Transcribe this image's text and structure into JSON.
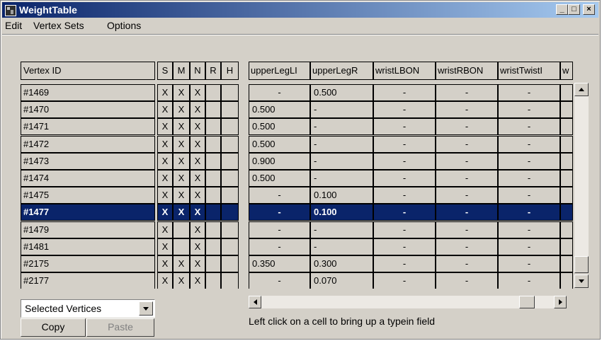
{
  "window": {
    "title": "WeightTable",
    "controls": {
      "minimize": "_",
      "maximize": "□",
      "close": "×"
    },
    "title_gradient": [
      "#0a246a",
      "#a6caf0"
    ]
  },
  "menu": {
    "items": [
      "Edit",
      "Vertex Sets",
      "Options"
    ]
  },
  "table": {
    "left_headers": [
      "Vertex ID",
      "S",
      "M",
      "N",
      "R",
      "H"
    ],
    "weight_headers": [
      "upperLegLI",
      "upperLegR",
      "wristLBON",
      "wristRBON",
      "wristTwistI",
      "w"
    ],
    "rows": [
      {
        "id": "#1469",
        "flags": [
          "X",
          "X",
          "X",
          "",
          ""
        ],
        "weights": [
          "-",
          "0.500",
          "-",
          "-",
          "-"
        ],
        "selected": false
      },
      {
        "id": "#1470",
        "flags": [
          "X",
          "X",
          "X",
          "",
          ""
        ],
        "weights": [
          "0.500",
          "-",
          "-",
          "-",
          "-"
        ],
        "selected": false
      },
      {
        "id": "#1471",
        "flags": [
          "X",
          "X",
          "X",
          "",
          ""
        ],
        "weights": [
          "0.500",
          "-",
          "-",
          "-",
          "-"
        ],
        "selected": false
      },
      {
        "id": "#1472",
        "flags": [
          "X",
          "X",
          "X",
          "",
          ""
        ],
        "weights": [
          "0.500",
          "-",
          "-",
          "-",
          "-"
        ],
        "selected": false
      },
      {
        "id": "#1473",
        "flags": [
          "X",
          "X",
          "X",
          "",
          ""
        ],
        "weights": [
          "0.900",
          "-",
          "-",
          "-",
          "-"
        ],
        "selected": false
      },
      {
        "id": "#1474",
        "flags": [
          "X",
          "X",
          "X",
          "",
          ""
        ],
        "weights": [
          "0.500",
          "-",
          "-",
          "-",
          "-"
        ],
        "selected": false
      },
      {
        "id": "#1475",
        "flags": [
          "X",
          "X",
          "X",
          "",
          ""
        ],
        "weights": [
          "-",
          "0.100",
          "-",
          "-",
          "-"
        ],
        "selected": false
      },
      {
        "id": "#1477",
        "flags": [
          "X",
          "X",
          "X",
          "",
          ""
        ],
        "weights": [
          "-",
          "0.100",
          "-",
          "-",
          "-"
        ],
        "selected": true
      },
      {
        "id": "#1479",
        "flags": [
          "X",
          "",
          "X",
          "",
          ""
        ],
        "weights": [
          "-",
          "-",
          "-",
          "-",
          "-"
        ],
        "selected": false
      },
      {
        "id": "#1481",
        "flags": [
          "X",
          "",
          "X",
          "",
          ""
        ],
        "weights": [
          "-",
          "-",
          "-",
          "-",
          "-"
        ],
        "selected": false
      },
      {
        "id": "#2175",
        "flags": [
          "X",
          "X",
          "X",
          "",
          ""
        ],
        "weights": [
          "0.350",
          "0.300",
          "-",
          "-",
          "-"
        ],
        "selected": false
      },
      {
        "id": "#2177",
        "flags": [
          "X",
          "X",
          "X",
          "",
          ""
        ],
        "weights": [
          "-",
          "0.070",
          "-",
          "-",
          "-"
        ],
        "selected": false
      }
    ]
  },
  "bottom": {
    "set_selector_value": "Selected Vertices",
    "copy_label": "Copy",
    "paste_label": "Paste",
    "hint": "Left click on a cell to bring up a typein field"
  },
  "colors": {
    "face": "#d4d0c8",
    "selection": "#0a246a"
  }
}
